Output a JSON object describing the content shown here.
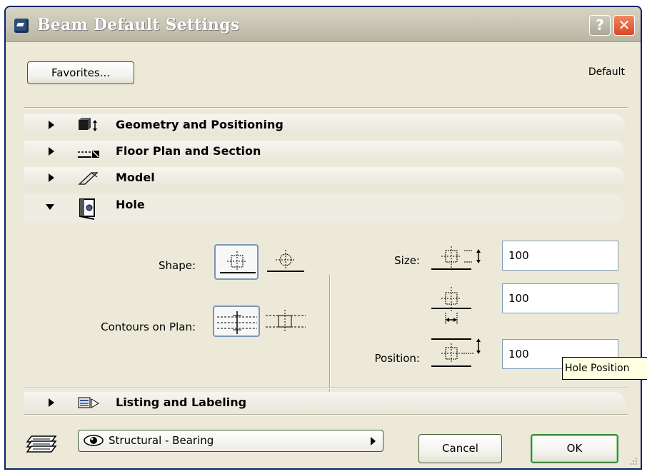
{
  "window": {
    "title": "Beam Default Settings",
    "help_label": "?",
    "close_label": "✕"
  },
  "header": {
    "favorites_label": "Favorites...",
    "default_label": "Default"
  },
  "panels": [
    {
      "label": "Geometry and Positioning",
      "icon": "geometry-icon",
      "expanded": false
    },
    {
      "label": "Floor Plan and Section",
      "icon": "floor-plan-icon",
      "expanded": false
    },
    {
      "label": "Model",
      "icon": "model-icon",
      "expanded": false
    },
    {
      "label": "Hole",
      "icon": "hole-icon",
      "expanded": true
    },
    {
      "label": "Listing and Labeling",
      "icon": "listing-icon",
      "expanded": false
    }
  ],
  "hole": {
    "shape_label": "Shape:",
    "contours_label": "Contours on Plan:",
    "size_label": "Size:",
    "position_label": "Position:",
    "width_value": "100",
    "height_value": "100",
    "position_value": "100",
    "selected_shape": "rectangular",
    "selected_contour": "solid"
  },
  "tooltip": {
    "text": "Hole Position"
  },
  "footer": {
    "layer_value": "Structural - Bearing",
    "cancel_label": "Cancel",
    "ok_label": "OK"
  },
  "colors": {
    "title_bar": "#c6c3b1",
    "window_bg": "#ece9d8",
    "close_button": "#d8482a",
    "selected_border": "#7b95b8"
  }
}
